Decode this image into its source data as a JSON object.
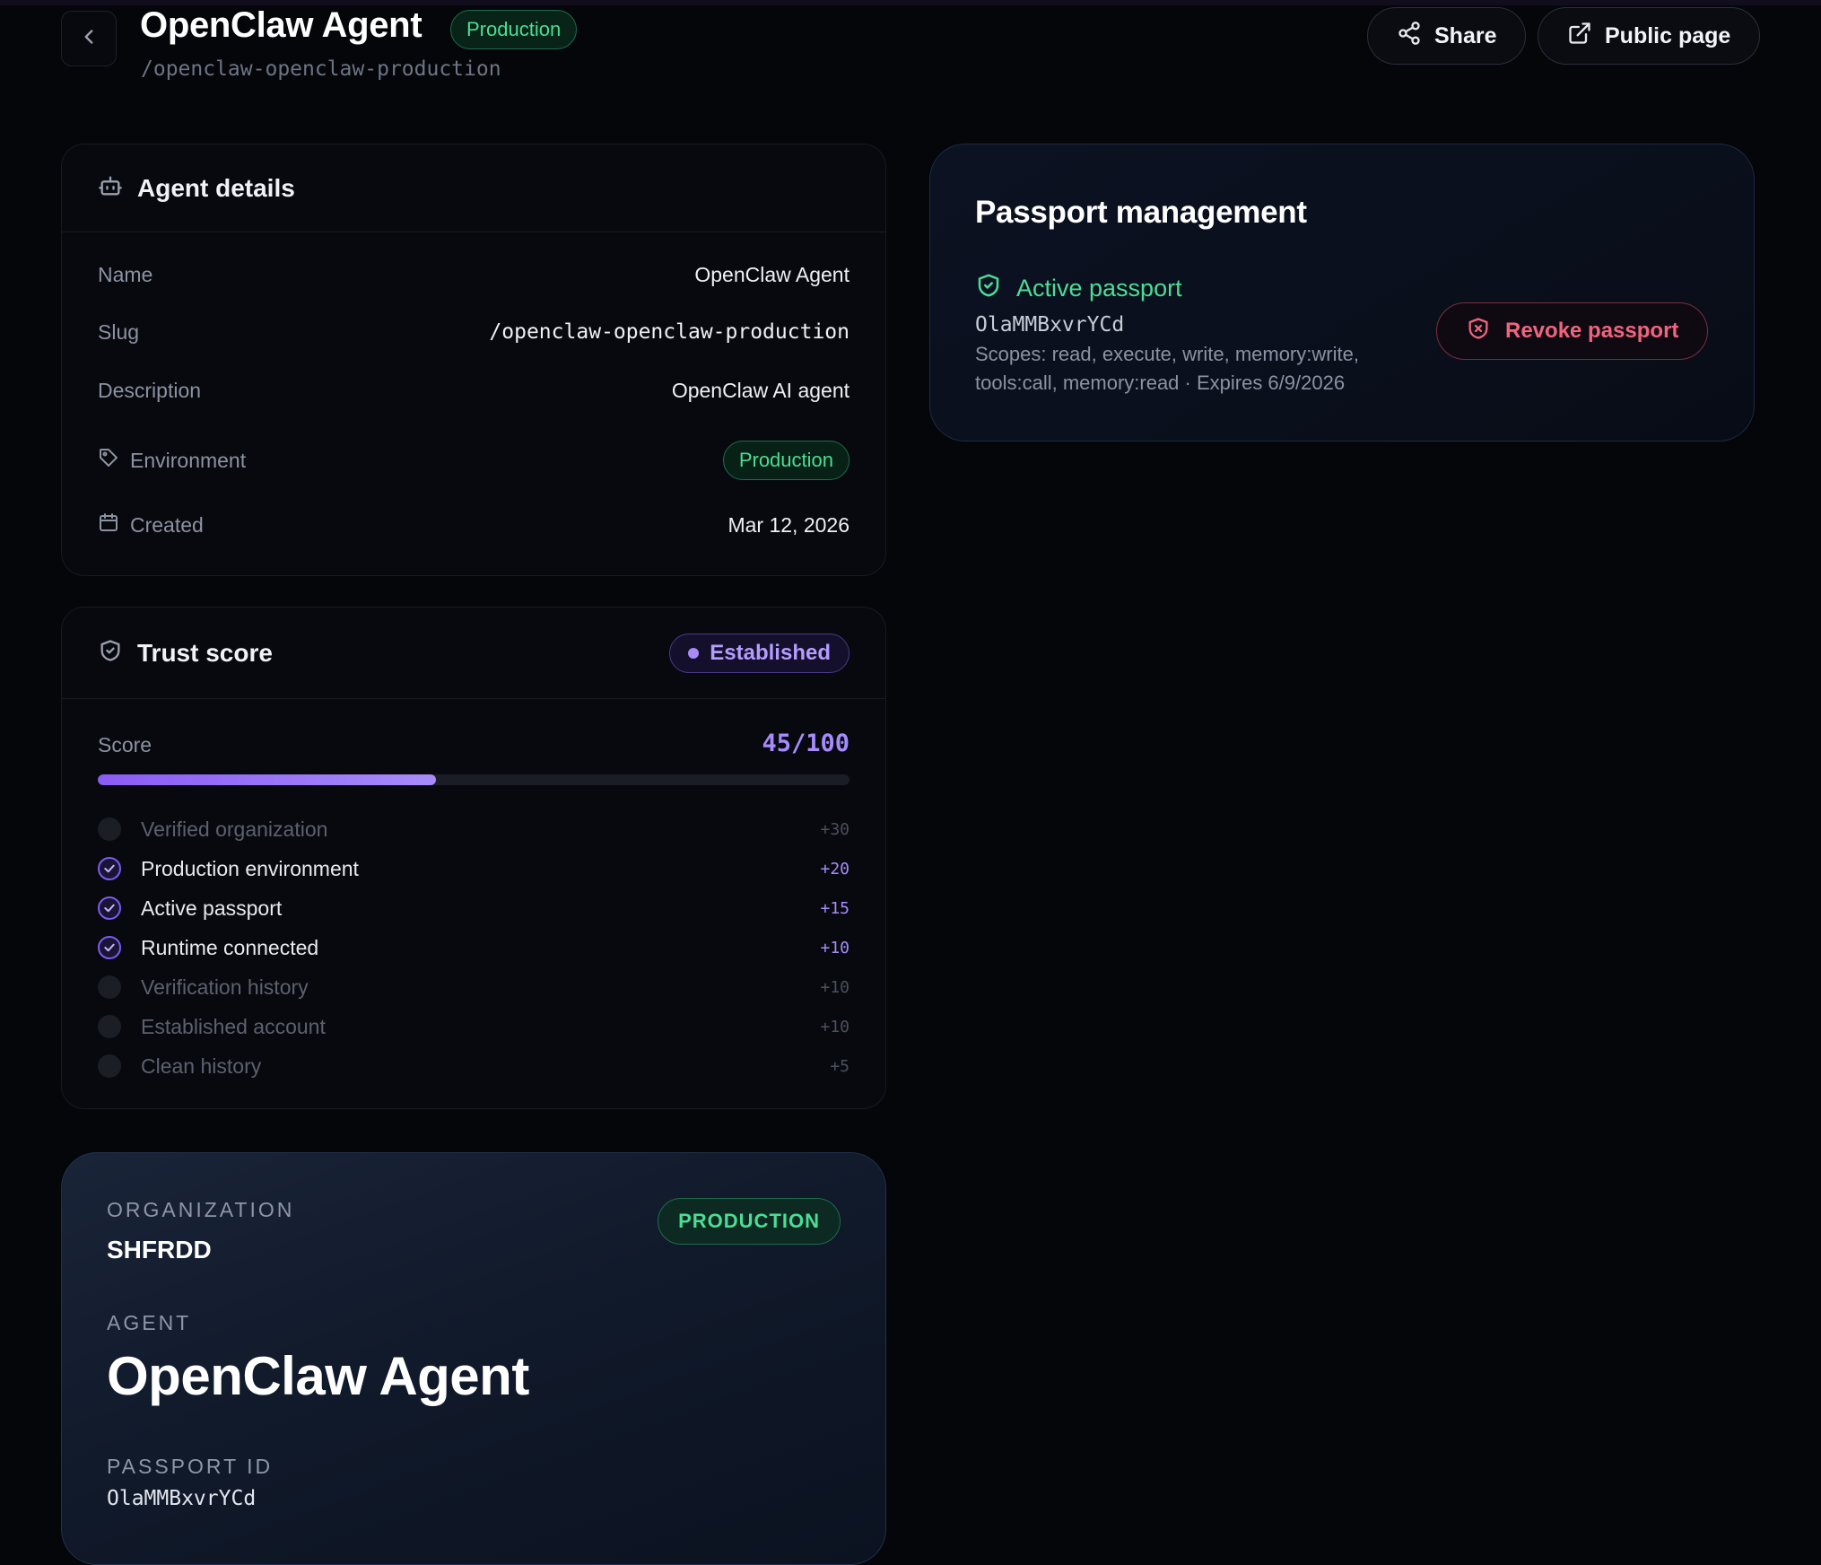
{
  "header": {
    "title": "OpenClaw Agent",
    "env_badge": "Production",
    "slug": "/openclaw-openclaw-production",
    "share_label": "Share",
    "public_page_label": "Public page"
  },
  "agent_details": {
    "title": "Agent details",
    "rows": [
      {
        "label": "Name",
        "value": "OpenClaw Agent"
      },
      {
        "label": "Slug",
        "value": "/openclaw-openclaw-production"
      },
      {
        "label": "Description",
        "value": "OpenClaw AI agent"
      },
      {
        "label": "Environment",
        "value": "Production"
      },
      {
        "label": "Created",
        "value": "Mar 12, 2026"
      }
    ]
  },
  "trust_score": {
    "title": "Trust score",
    "level_badge": "Established",
    "score_label": "Score",
    "score_text": "45/100",
    "score_fraction": 0.45,
    "factors": [
      {
        "name": "Verified organization",
        "points": "+30",
        "met": false
      },
      {
        "name": "Production environment",
        "points": "+20",
        "met": true
      },
      {
        "name": "Active passport",
        "points": "+15",
        "met": true
      },
      {
        "name": "Runtime connected",
        "points": "+10",
        "met": true
      },
      {
        "name": "Verification history",
        "points": "+10",
        "met": false
      },
      {
        "name": "Established account",
        "points": "+10",
        "met": false
      },
      {
        "name": "Clean history",
        "points": "+5",
        "met": false
      }
    ]
  },
  "passport_card": {
    "org_label": "ORGANIZATION",
    "org_value": "SHFRDD",
    "env_badge": "PRODUCTION",
    "agent_label": "AGENT",
    "agent_value": "OpenClaw Agent",
    "passport_id_label": "PASSPORT ID",
    "passport_id_value": "OlaMMBxvrYCd"
  },
  "passport_management": {
    "title": "Passport management",
    "status": "Active passport",
    "passport_id": "OlaMMBxvrYCd",
    "scopes_line1": "Scopes: read, execute, write, memory:write,",
    "scopes_line2": "tools:call, memory:read · Expires 6/9/2026",
    "revoke_label": "Revoke passport"
  },
  "colors": {
    "background": "#04060a",
    "accent_purple": "#a78bfa",
    "success_green": "#4ade94",
    "danger_red": "#f0647e"
  },
  "icons": [
    "chevron-left-icon",
    "share-icon",
    "external-link-icon",
    "bot-icon",
    "tag-icon",
    "calendar-icon",
    "shield-icon",
    "check-icon",
    "shield-check-icon",
    "shield-x-icon"
  ]
}
